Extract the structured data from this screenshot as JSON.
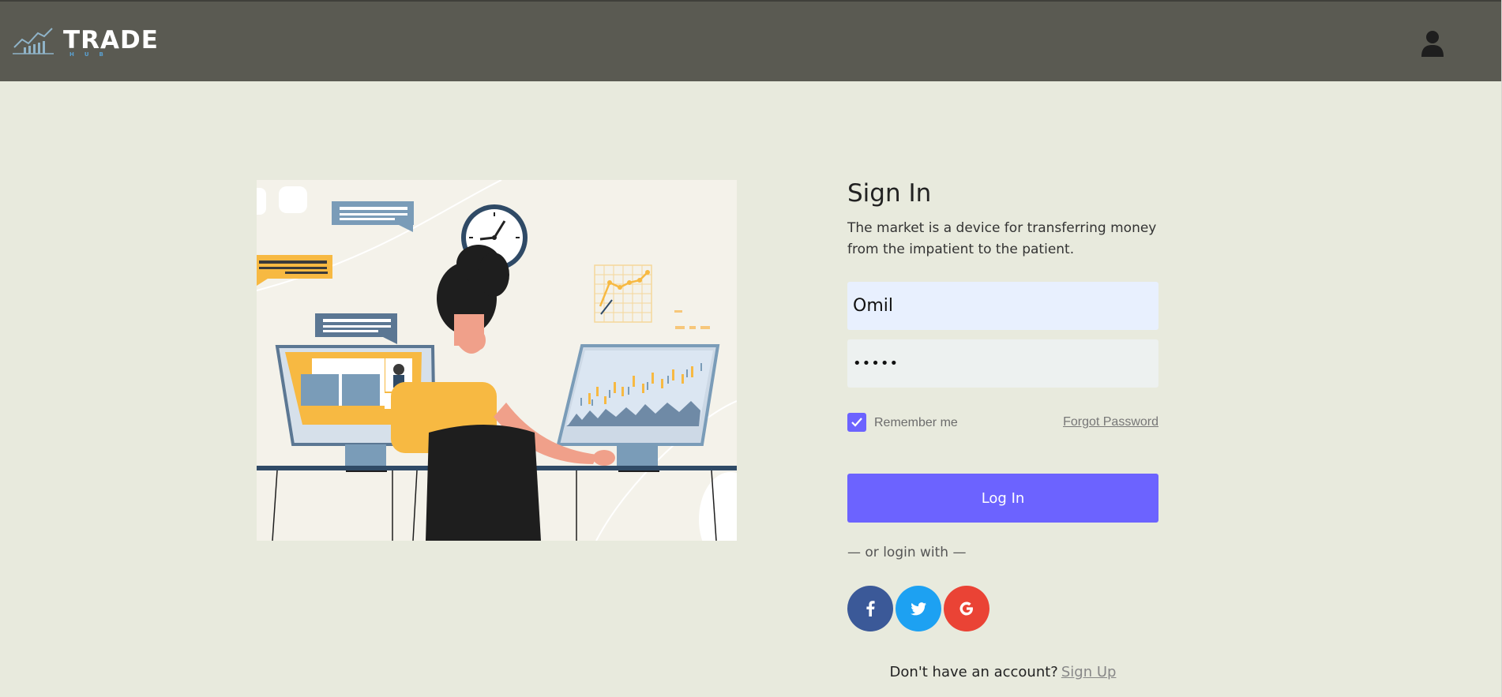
{
  "header": {
    "logo_text": "TRADE",
    "logo_subtext": "HUB",
    "user_icon": "user-icon"
  },
  "illustration": {
    "description_icon": "trader-at-desk-illustration"
  },
  "signin": {
    "title": "Sign In",
    "subtitle": "The market is a device for transferring money from the impatient to the patient.",
    "username_value": "Omil",
    "password_value": "•••••",
    "remember_label": "Remember me",
    "remember_checked": true,
    "forgot_label": "Forgot Password",
    "login_label": "Log In",
    "or_text": "— or login with —",
    "signup_prompt": "Don't have an account?",
    "signup_label": "Sign Up"
  },
  "socials": [
    {
      "name": "facebook",
      "icon": "facebook-icon",
      "color": "#3b5998"
    },
    {
      "name": "twitter",
      "icon": "twitter-icon",
      "color": "#1da1f2"
    },
    {
      "name": "google",
      "icon": "google-icon",
      "color": "#ea4335"
    }
  ],
  "colors": {
    "header_bg": "#5a5a52",
    "page_bg": "#e8eadd",
    "accent": "#6c63ff"
  }
}
